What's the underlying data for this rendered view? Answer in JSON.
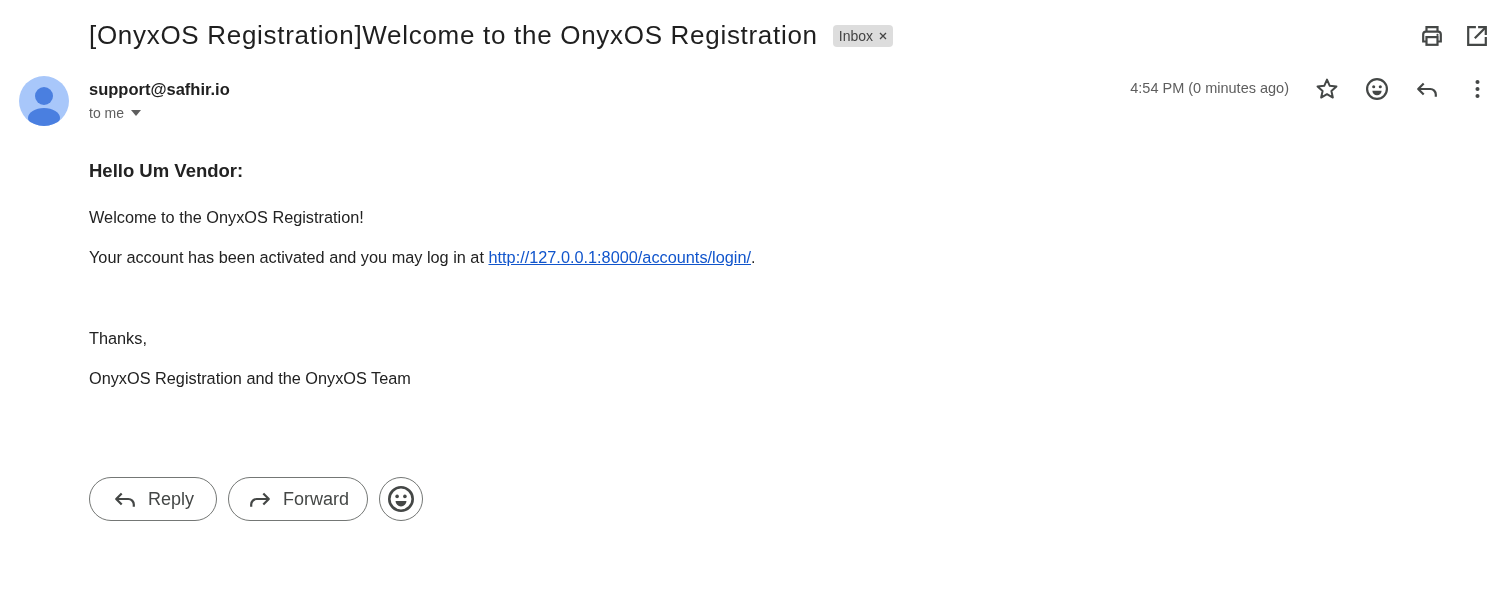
{
  "subject": {
    "title": "[OnyxOS Registration]Welcome to the OnyxOS Registration",
    "labels": [
      "Inbox"
    ]
  },
  "message": {
    "sender": "support@safhir.io",
    "recipient": "to me",
    "time": "4:54 PM (0 minutes ago)",
    "starred": false
  },
  "body": {
    "greeting": "Hello Um Vendor:",
    "paragraphs": [
      {
        "text": "Welcome to the OnyxOS Registration!"
      },
      {
        "text": "Your account has been activated and you may log in at ",
        "link": "http://127.0.0.1:8000/accounts/login/",
        "after": "."
      }
    ],
    "closing": [
      "Thanks,",
      "OnyxOS Registration and the OnyxOS Team"
    ]
  },
  "actions": [
    {
      "kind": "reply",
      "label": "Reply"
    },
    {
      "kind": "forward",
      "label": "Forward"
    },
    {
      "kind": "emoji"
    }
  ]
}
